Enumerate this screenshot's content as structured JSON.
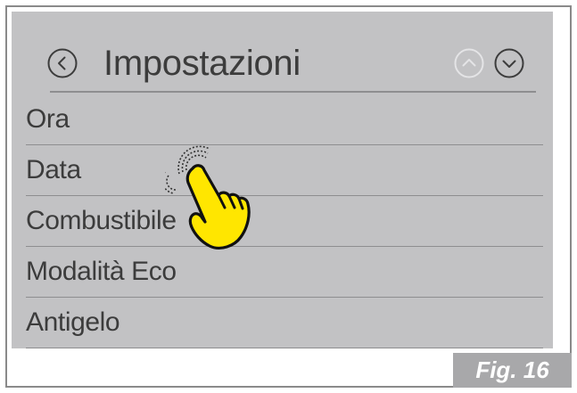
{
  "header": {
    "title": "Impostazioni",
    "back_icon": "chevron-left-circle-icon",
    "up_icon": "chevron-up-circle-icon",
    "down_icon": "chevron-down-circle-icon"
  },
  "menu": {
    "items": [
      {
        "label": "Ora"
      },
      {
        "label": "Data"
      },
      {
        "label": "Combustibile"
      },
      {
        "label": "Modalità Eco"
      },
      {
        "label": "Antigelo"
      }
    ]
  },
  "gesture": {
    "icon": "tap-hand-icon"
  },
  "figure": {
    "label": "Fig. 16"
  },
  "colors": {
    "screen_bg": "#c2c2c4",
    "text": "#3c3c3c",
    "hand_fill": "#ffe600",
    "fig_label_bg": "#a8a8aa"
  }
}
